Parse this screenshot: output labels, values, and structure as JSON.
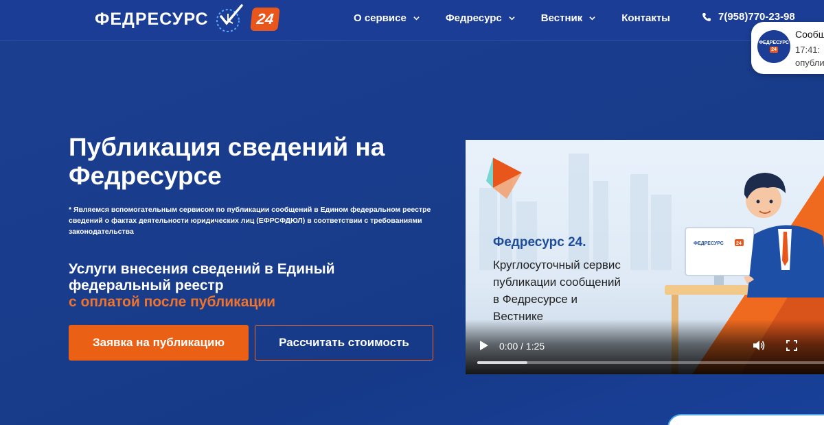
{
  "header": {
    "logo_text": "ФЕДРЕСУРС",
    "logo_badge": "24",
    "nav": [
      {
        "label": "О сервисе",
        "has_dropdown": true
      },
      {
        "label": "Федресурс",
        "has_dropdown": true
      },
      {
        "label": "Вестник",
        "has_dropdown": true
      },
      {
        "label": "Контакты",
        "has_dropdown": false
      }
    ],
    "phone": "7(958)770-23-98",
    "phone_icon": "phone-icon"
  },
  "notification": {
    "avatar_text": "ФЕДРЕСУРС",
    "avatar_badge": "24",
    "title": "Сообщ",
    "line1": "17:41:",
    "line2": "опубли"
  },
  "hero": {
    "title": "Публикация сведений на Федресурсе",
    "note": "* Являемся вспомогательным сервисом по публикации сообщений в Едином федеральном реестре сведений о фактах деятельности юридических лиц (ЕФРСФДЮЛ) в соответствии с требованиями законодательства",
    "services_line": "Услуги внесения сведений в Единый федеральный реестр",
    "services_accent": "с оплатой после публикации",
    "primary_button": "Заявка на публикацию",
    "secondary_button": "Рассчитать стоимость"
  },
  "video": {
    "caption_title": "Федресурс 24.",
    "caption_lines": [
      "Круглосуточный сервис",
      "публикации сообщений",
      "в Федресурсе и",
      "Вестнике"
    ],
    "monitor_logo": "ФЕДРЕСУРС",
    "monitor_badge": "24",
    "time": "0:00 / 1:25",
    "progress_fraction": 0.0,
    "buffered_fraction": 0.14
  },
  "colors": {
    "brand_blue": "#1b3d95",
    "accent_orange": "#ea6014",
    "accent_text_orange": "#f0732b"
  }
}
